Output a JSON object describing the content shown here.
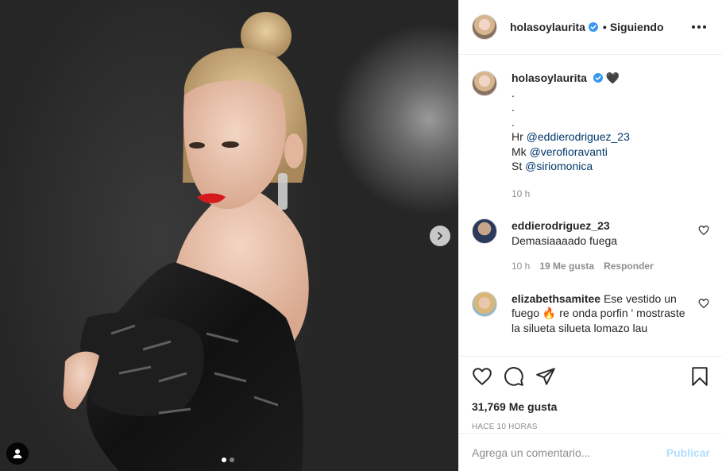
{
  "post": {
    "dots": [
      true,
      false
    ]
  },
  "header": {
    "username": "holasoylaurita",
    "separator": "•",
    "follow_status": "Siguiendo"
  },
  "caption": {
    "username": "holasoylaurita",
    "emoji": "🖤",
    "lines": [
      ".",
      ".",
      "."
    ],
    "credits": [
      {
        "prefix": "Hr",
        "mention": "@eddierodriguez_23"
      },
      {
        "prefix": "Mk",
        "mention": "@verofioravanti"
      },
      {
        "prefix": "St",
        "mention": "@siriomonica"
      }
    ],
    "time": "10 h"
  },
  "comments": [
    {
      "username": "eddierodriguez_23",
      "text": "Demasiaaaado fuega",
      "time": "10 h",
      "likes": "19 Me gusta",
      "reply": "Responder"
    },
    {
      "username": "elizabethsamitee",
      "text": "Ese vestido un fuego 🔥 re onda porfin ' mostraste la silueta silueta lomazo lau"
    }
  ],
  "actions": {
    "likes": "31,769 Me gusta",
    "timestamp": "HACE 10 HORAS"
  },
  "add_comment": {
    "placeholder": "Agrega un comentario...",
    "publish": "Publicar"
  },
  "colors": {
    "mention": "#00376b",
    "verified": "#3897f0",
    "publish_disabled": "#b2dffc",
    "muted": "#8e8e8e"
  }
}
